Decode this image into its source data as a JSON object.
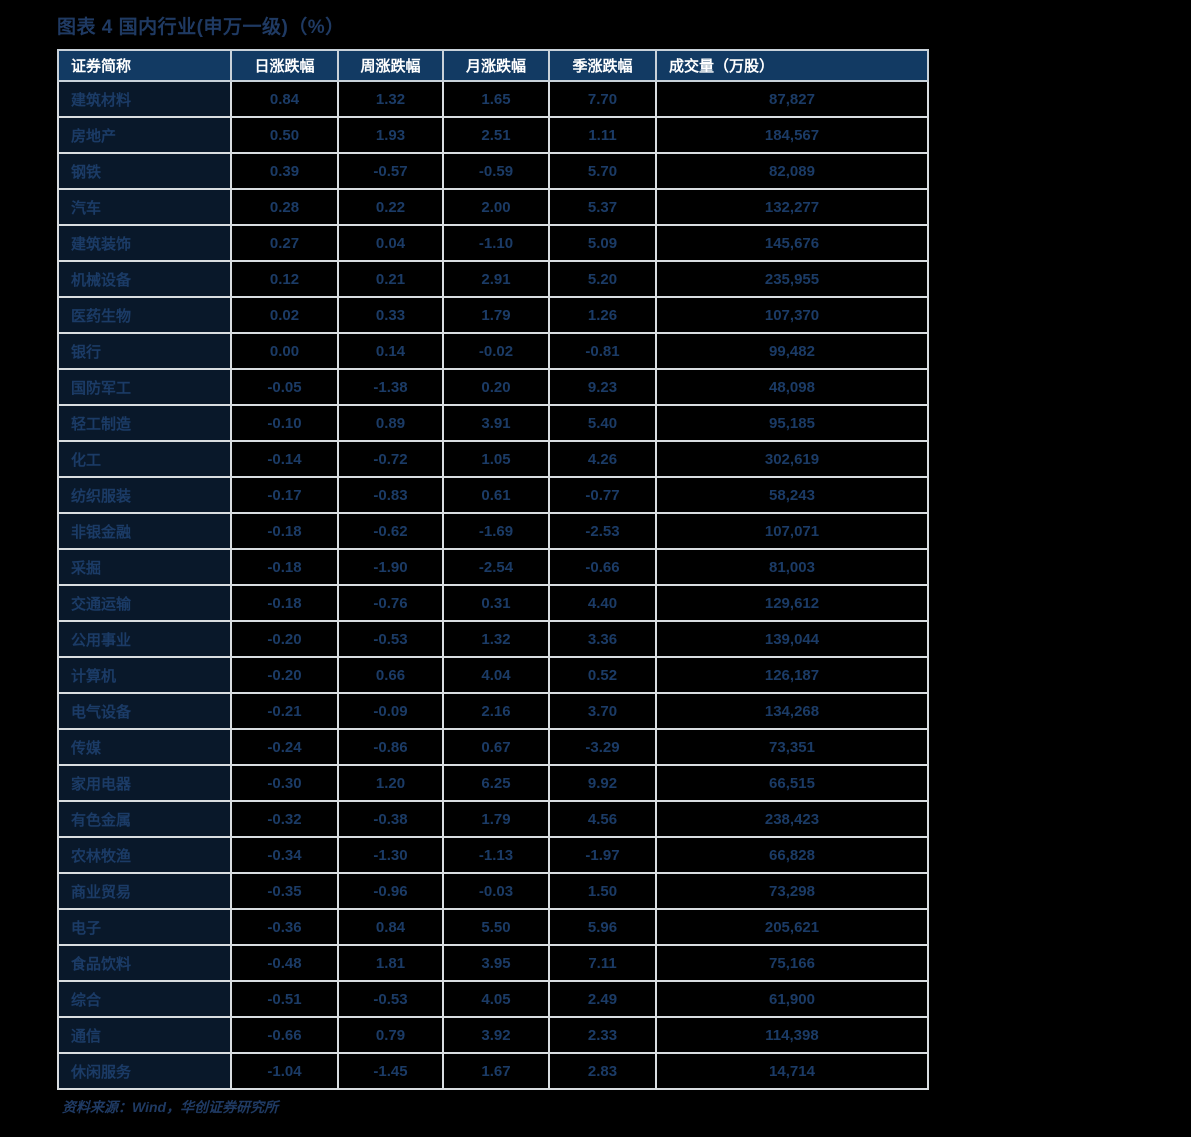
{
  "figure": {
    "title": "图表 4   国内行业(申万一级)（%）",
    "source_note": "资料来源：Wind，华创证券研究所"
  },
  "colors": {
    "header_bg": "#123a63",
    "header_text": "#ffffff",
    "value_text": "#1b3b66",
    "title_text": "#1f3a63",
    "grid_line": "#d9dde1",
    "page_bg": "#000000",
    "name_cell_bg": "#09182a"
  },
  "table": {
    "columns": [
      "证券简称",
      "日涨跌幅",
      "周涨跌幅",
      "月涨跌幅",
      "季涨跌幅",
      "成交量（万股）"
    ],
    "rows": [
      {
        "name": "建筑材料",
        "day": "0.84",
        "week": "1.32",
        "month": "1.65",
        "quarter": "7.70",
        "volume": "87,827"
      },
      {
        "name": "房地产",
        "day": "0.50",
        "week": "1.93",
        "month": "2.51",
        "quarter": "1.11",
        "volume": "184,567"
      },
      {
        "name": "钢铁",
        "day": "0.39",
        "week": "-0.57",
        "month": "-0.59",
        "quarter": "5.70",
        "volume": "82,089"
      },
      {
        "name": "汽车",
        "day": "0.28",
        "week": "0.22",
        "month": "2.00",
        "quarter": "5.37",
        "volume": "132,277"
      },
      {
        "name": "建筑装饰",
        "day": "0.27",
        "week": "0.04",
        "month": "-1.10",
        "quarter": "5.09",
        "volume": "145,676"
      },
      {
        "name": "机械设备",
        "day": "0.12",
        "week": "0.21",
        "month": "2.91",
        "quarter": "5.20",
        "volume": "235,955"
      },
      {
        "name": "医药生物",
        "day": "0.02",
        "week": "0.33",
        "month": "1.79",
        "quarter": "1.26",
        "volume": "107,370"
      },
      {
        "name": "银行",
        "day": "0.00",
        "week": "0.14",
        "month": "-0.02",
        "quarter": "-0.81",
        "volume": "99,482"
      },
      {
        "name": "国防军工",
        "day": "-0.05",
        "week": "-1.38",
        "month": "0.20",
        "quarter": "9.23",
        "volume": "48,098"
      },
      {
        "name": "轻工制造",
        "day": "-0.10",
        "week": "0.89",
        "month": "3.91",
        "quarter": "5.40",
        "volume": "95,185"
      },
      {
        "name": "化工",
        "day": "-0.14",
        "week": "-0.72",
        "month": "1.05",
        "quarter": "4.26",
        "volume": "302,619"
      },
      {
        "name": "纺织服装",
        "day": "-0.17",
        "week": "-0.83",
        "month": "0.61",
        "quarter": "-0.77",
        "volume": "58,243"
      },
      {
        "name": "非银金融",
        "day": "-0.18",
        "week": "-0.62",
        "month": "-1.69",
        "quarter": "-2.53",
        "volume": "107,071"
      },
      {
        "name": "采掘",
        "day": "-0.18",
        "week": "-1.90",
        "month": "-2.54",
        "quarter": "-0.66",
        "volume": "81,003"
      },
      {
        "name": "交通运输",
        "day": "-0.18",
        "week": "-0.76",
        "month": "0.31",
        "quarter": "4.40",
        "volume": "129,612"
      },
      {
        "name": "公用事业",
        "day": "-0.20",
        "week": "-0.53",
        "month": "1.32",
        "quarter": "3.36",
        "volume": "139,044"
      },
      {
        "name": "计算机",
        "day": "-0.20",
        "week": "0.66",
        "month": "4.04",
        "quarter": "0.52",
        "volume": "126,187"
      },
      {
        "name": "电气设备",
        "day": "-0.21",
        "week": "-0.09",
        "month": "2.16",
        "quarter": "3.70",
        "volume": "134,268"
      },
      {
        "name": "传媒",
        "day": "-0.24",
        "week": "-0.86",
        "month": "0.67",
        "quarter": "-3.29",
        "volume": "73,351"
      },
      {
        "name": "家用电器",
        "day": "-0.30",
        "week": "1.20",
        "month": "6.25",
        "quarter": "9.92",
        "volume": "66,515"
      },
      {
        "name": "有色金属",
        "day": "-0.32",
        "week": "-0.38",
        "month": "1.79",
        "quarter": "4.56",
        "volume": "238,423"
      },
      {
        "name": "农林牧渔",
        "day": "-0.34",
        "week": "-1.30",
        "month": "-1.13",
        "quarter": "-1.97",
        "volume": "66,828"
      },
      {
        "name": "商业贸易",
        "day": "-0.35",
        "week": "-0.96",
        "month": "-0.03",
        "quarter": "1.50",
        "volume": "73,298"
      },
      {
        "name": "电子",
        "day": "-0.36",
        "week": "0.84",
        "month": "5.50",
        "quarter": "5.96",
        "volume": "205,621"
      },
      {
        "name": "食品饮料",
        "day": "-0.48",
        "week": "1.81",
        "month": "3.95",
        "quarter": "7.11",
        "volume": "75,166"
      },
      {
        "name": "综合",
        "day": "-0.51",
        "week": "-0.53",
        "month": "4.05",
        "quarter": "2.49",
        "volume": "61,900"
      },
      {
        "name": "通信",
        "day": "-0.66",
        "week": "0.79",
        "month": "3.92",
        "quarter": "2.33",
        "volume": "114,398"
      },
      {
        "name": "休闲服务",
        "day": "-1.04",
        "week": "-1.45",
        "month": "1.67",
        "quarter": "2.83",
        "volume": "14,714"
      }
    ]
  },
  "chart_data": {
    "type": "table",
    "title": "图表 4   国内行业(申万一级)（%）",
    "columns": [
      "证券简称",
      "日涨跌幅",
      "周涨跌幅",
      "月涨跌幅",
      "季涨跌幅",
      "成交量（万股）"
    ],
    "categories": [
      "建筑材料",
      "房地产",
      "钢铁",
      "汽车",
      "建筑装饰",
      "机械设备",
      "医药生物",
      "银行",
      "国防军工",
      "轻工制造",
      "化工",
      "纺织服装",
      "非银金融",
      "采掘",
      "交通运输",
      "公用事业",
      "计算机",
      "电气设备",
      "传媒",
      "家用电器",
      "有色金属",
      "农林牧渔",
      "商业贸易",
      "电子",
      "食品饮料",
      "综合",
      "通信",
      "休闲服务"
    ],
    "series": [
      {
        "name": "日涨跌幅",
        "values": [
          0.84,
          0.5,
          0.39,
          0.28,
          0.27,
          0.12,
          0.02,
          0.0,
          -0.05,
          -0.1,
          -0.14,
          -0.17,
          -0.18,
          -0.18,
          -0.18,
          -0.2,
          -0.2,
          -0.21,
          -0.24,
          -0.3,
          -0.32,
          -0.34,
          -0.35,
          -0.36,
          -0.48,
          -0.51,
          -0.66,
          -1.04
        ]
      },
      {
        "name": "周涨跌幅",
        "values": [
          1.32,
          1.93,
          -0.57,
          0.22,
          0.04,
          0.21,
          0.33,
          0.14,
          -1.38,
          0.89,
          -0.72,
          -0.83,
          -0.62,
          -1.9,
          -0.76,
          -0.53,
          0.66,
          -0.09,
          -0.86,
          1.2,
          -0.38,
          -1.3,
          -0.96,
          0.84,
          1.81,
          -0.53,
          0.79,
          -1.45
        ]
      },
      {
        "name": "月涨跌幅",
        "values": [
          1.65,
          2.51,
          -0.59,
          2.0,
          -1.1,
          2.91,
          1.79,
          -0.02,
          0.2,
          3.91,
          1.05,
          0.61,
          -1.69,
          -2.54,
          0.31,
          1.32,
          4.04,
          2.16,
          0.67,
          6.25,
          1.79,
          -1.13,
          -0.03,
          5.5,
          3.95,
          4.05,
          3.92,
          1.67
        ]
      },
      {
        "name": "季涨跌幅",
        "values": [
          7.7,
          1.11,
          5.7,
          5.37,
          5.09,
          5.2,
          1.26,
          -0.81,
          9.23,
          5.4,
          4.26,
          -0.77,
          -2.53,
          -0.66,
          4.4,
          3.36,
          0.52,
          3.7,
          -3.29,
          9.92,
          4.56,
          -1.97,
          1.5,
          5.96,
          7.11,
          2.49,
          2.33,
          2.83
        ]
      },
      {
        "name": "成交量（万股）",
        "values": [
          87827,
          184567,
          82089,
          132277,
          145676,
          235955,
          107370,
          99482,
          48098,
          95185,
          302619,
          58243,
          107071,
          81003,
          129612,
          139044,
          126187,
          134268,
          73351,
          66515,
          238423,
          66828,
          73298,
          205621,
          75166,
          61900,
          114398,
          14714
        ]
      }
    ],
    "xlabel": "",
    "ylabel": "",
    "grid": true,
    "legend": "none",
    "source": "资料来源：Wind，华创证券研究所"
  }
}
